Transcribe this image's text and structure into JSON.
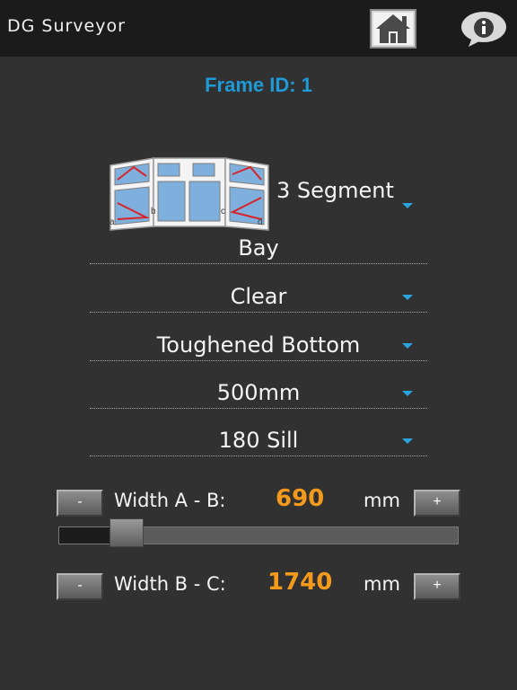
{
  "app": {
    "title": "DG Surveyor"
  },
  "icons": {
    "home": "home-icon",
    "info": "info-icon"
  },
  "frame": {
    "id_label": "Frame ID: 1"
  },
  "window_type": {
    "selected": "3 Segment",
    "corner_labels": [
      "a",
      "b",
      "c",
      "d"
    ]
  },
  "fields": [
    {
      "value": "Bay",
      "dropdown": false
    },
    {
      "value": "Clear",
      "dropdown": true
    },
    {
      "value": "Toughened Bottom",
      "dropdown": true
    },
    {
      "value": "500mm",
      "dropdown": true
    },
    {
      "value": "180 Sill",
      "dropdown": true
    }
  ],
  "width_ab": {
    "minus": "-",
    "label": "Width A - B:",
    "value": "690",
    "unit": "mm",
    "plus": "+",
    "slider_fraction": 0.14
  },
  "width_bc": {
    "minus": "-",
    "label": "Width B - C:",
    "value": "1740",
    "unit": "mm",
    "plus": "+"
  },
  "colors": {
    "accent_blue": "#1f9ad6",
    "value_orange": "#f39a1c",
    "background": "#313131",
    "appbar": "#1b1b1b"
  }
}
